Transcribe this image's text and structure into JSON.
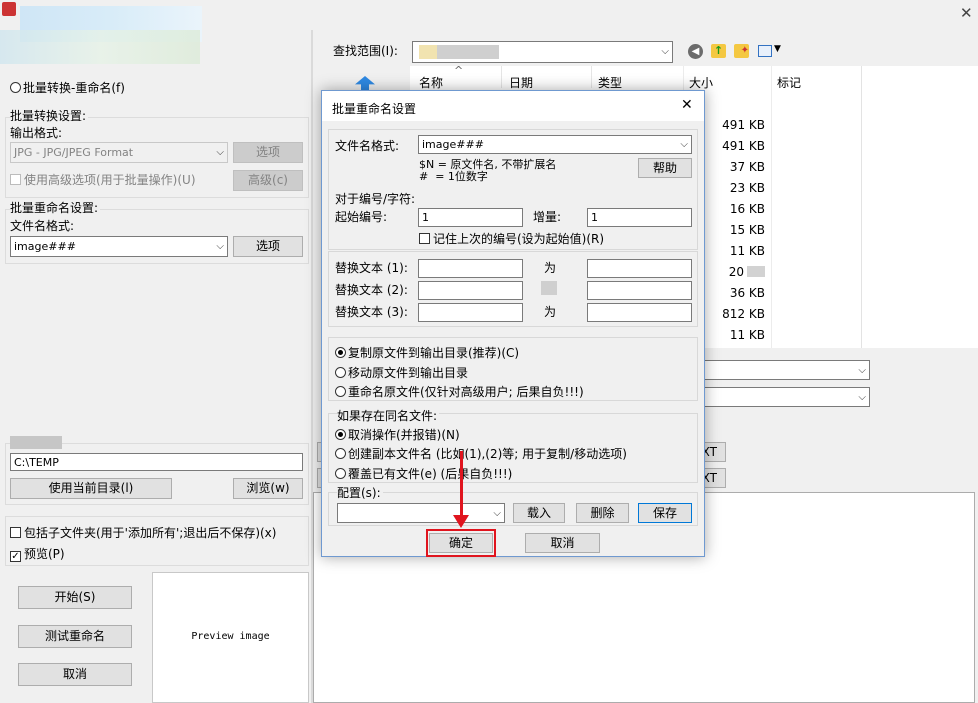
{
  "main_window": {
    "rename_only_radio": "批量转换-重命名(f)",
    "batch_convert_group": "批量转换设置:",
    "output_format_label": "输出格式:",
    "output_format_value": "JPG - JPG/JPEG Format",
    "options_button_1": "选项",
    "advanced_checkbox": "使用高级选项(用于批量操作)(U)",
    "advanced_button": "高级(c)",
    "batch_rename_group": "批量重命名设置:",
    "filename_format_label": "文件名格式:",
    "filename_format_value": "image###",
    "options_button_2": "选项",
    "output_dir_value": "C:\\TEMP",
    "use_current_dir_button": "使用当前目录(l)",
    "browse_button": "浏览(w)",
    "include_subfolders_checkbox": "包括子文件夹(用于'添加所有';退出后不保存)(x)",
    "preview_checkbox": "预览(P)",
    "start_button": "开始(S)",
    "test_rename_button": "测试重命名",
    "cancel_button": "取消",
    "preview_text": "Preview image"
  },
  "file_browser": {
    "look_in_label": "查找范围(I):",
    "columns": [
      "名称",
      "日期",
      "类型",
      "大小",
      "标记"
    ],
    "sizes": [
      "491 KB",
      "491 KB",
      "37 KB",
      "23 KB",
      "16 KB",
      "15 KB",
      "11 KB",
      "20",
      "36 KB",
      "812 KB",
      "11 KB"
    ],
    "right_btn_1": "XT",
    "right_btn_2": "XT"
  },
  "dialog": {
    "title": "批量重命名设置",
    "close_glyph": "✕",
    "filename_format_label": "文件名格式:",
    "filename_format_value": "image###",
    "help_line_1": "$N = 原文件名, 不带扩展名",
    "help_line_2": "#  = 1位数字",
    "help_button": "帮助",
    "numbering_label": "对于编号/字符:",
    "start_number_label": "起始编号:",
    "start_number_value": "1",
    "increment_label": "增量:",
    "increment_value": "1",
    "remember_checkbox": "记住上次的编号(设为起始值)(R)",
    "replace_1_label": "替换文本 (1):",
    "replace_2_label": "替换文本 (2):",
    "replace_3_label": "替换文本 (3):",
    "with_label_1": "为",
    "with_label_3": "为",
    "copy_radio": "复制原文件到输出目录(推荐)(C)",
    "move_radio": "移动原文件到输出目录",
    "rename_radio": "重命名原文件(仅针对高级用户; 后果自负!!!)",
    "exists_label": "如果存在同名文件:",
    "cancel_op_radio": "取消操作(并报错)(N)",
    "create_copy_radio": "创建副本文件名 (比如(1),(2)等; 用于复制/移动选项)",
    "overwrite_radio": "覆盖已有文件(e) (后果自负!!!)",
    "config_label": "配置(s):",
    "load_button": "载入",
    "delete_button": "删除",
    "save_button": "保存",
    "ok_button": "确定",
    "cancel_button": "取消"
  },
  "colors": {
    "highlight_red": "#e0141e",
    "dialog_border": "#6f99d0",
    "folder_icon": "#2f89e3"
  },
  "icons": [
    "back-icon",
    "up-folder-icon",
    "new-folder-icon",
    "view-menu-icon",
    "folder-arrow-icon"
  ]
}
